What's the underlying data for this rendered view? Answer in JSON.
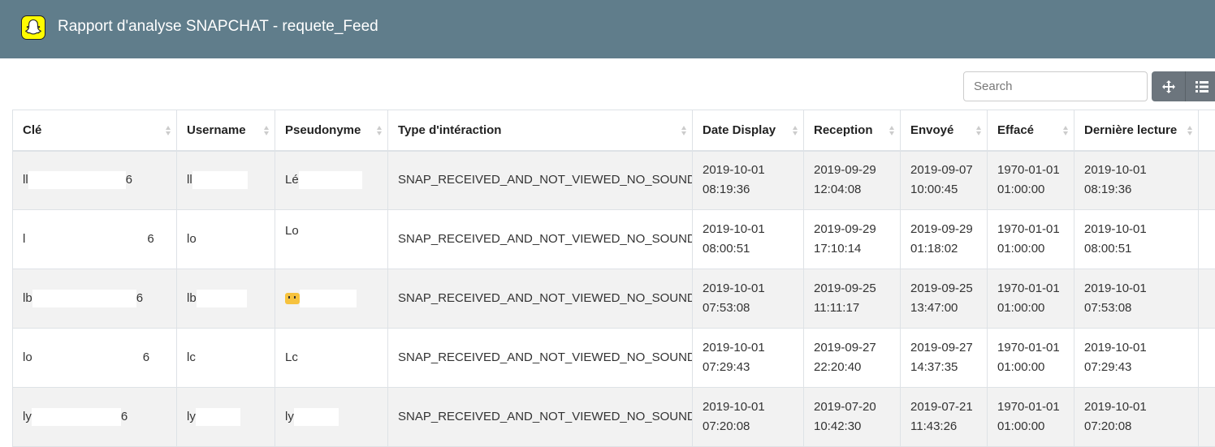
{
  "header": {
    "title": "Rapport d'analyse SNAPCHAT - requete_Feed",
    "brand_color": "#607d8b",
    "logo_color": "#fffc00"
  },
  "toolbar": {
    "search_placeholder": "Search",
    "move_icon": "arrows-move-icon",
    "list_icon": "list-view-icon"
  },
  "table": {
    "columns": [
      "Clé",
      "Username",
      "Pseudonyme",
      "Type d'intéraction",
      "Date Display",
      "Reception",
      "Envoyé",
      "Effacé",
      "Dernière lecture"
    ],
    "rows": [
      {
        "cle": "ll",
        "cle_end": "6",
        "username": "ll",
        "pseudonyme": "Lé",
        "type": "SNAP_RECEIVED_AND_NOT_VIEWED_NO_SOUND",
        "date_display": [
          "2019-10-01",
          "08:19:36"
        ],
        "reception": [
          "2019-09-29",
          "12:04:08"
        ],
        "envoye": [
          "2019-09-07",
          "10:00:45"
        ],
        "efface": [
          "1970-01-01",
          "01:00:00"
        ],
        "derniere": [
          "2019-10-01",
          "08:19:36"
        ]
      },
      {
        "cle": "l",
        "cle_end": "6",
        "username": "lo",
        "pseudonyme": "Lo",
        "type": "SNAP_RECEIVED_AND_NOT_VIEWED_NO_SOUND",
        "date_display": [
          "2019-10-01",
          "08:00:51"
        ],
        "reception": [
          "2019-09-29",
          "17:10:14"
        ],
        "envoye": [
          "2019-09-29",
          "01:18:02"
        ],
        "efface": [
          "1970-01-01",
          "01:00:00"
        ],
        "derniere": [
          "2019-10-01",
          "08:00:51"
        ]
      },
      {
        "cle": "lb",
        "cle_end": "6",
        "username": "lb",
        "pseudonyme": "",
        "type": "SNAP_RECEIVED_AND_NOT_VIEWED_NO_SOUND",
        "date_display": [
          "2019-10-01",
          "07:53:08"
        ],
        "reception": [
          "2019-09-25",
          "11:11:17"
        ],
        "envoye": [
          "2019-09-25",
          "13:47:00"
        ],
        "efface": [
          "1970-01-01",
          "01:00:00"
        ],
        "derniere": [
          "2019-10-01",
          "07:53:08"
        ]
      },
      {
        "cle": "lo",
        "cle_end": "6",
        "username": "lc",
        "pseudonyme": "Lc",
        "type": "SNAP_RECEIVED_AND_NOT_VIEWED_NO_SOUND",
        "date_display": [
          "2019-10-01",
          "07:29:43"
        ],
        "reception": [
          "2019-09-27",
          "22:20:40"
        ],
        "envoye": [
          "2019-09-27",
          "14:37:35"
        ],
        "efface": [
          "1970-01-01",
          "01:00:00"
        ],
        "derniere": [
          "2019-10-01",
          "07:29:43"
        ]
      },
      {
        "cle": "ly",
        "cle_end": "6",
        "username": "ly",
        "pseudonyme": "ly",
        "type": "SNAP_RECEIVED_AND_NOT_VIEWED_NO_SOUND",
        "date_display": [
          "2019-10-01",
          "07:20:08"
        ],
        "reception": [
          "2019-07-20",
          "10:42:30"
        ],
        "envoye": [
          "2019-07-21",
          "11:43:26"
        ],
        "efface": [
          "1970-01-01",
          "01:00:00"
        ],
        "derniere": [
          "2019-10-01",
          "07:20:08"
        ]
      }
    ]
  }
}
